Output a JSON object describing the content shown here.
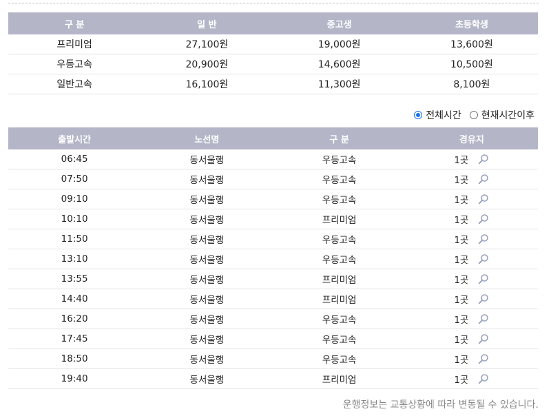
{
  "fare_table": {
    "headers": [
      "구 분",
      "일 반",
      "중고생",
      "초등학생"
    ],
    "rows": [
      [
        "프리미엄",
        "27,100원",
        "19,000원",
        "13,600원"
      ],
      [
        "우등고속",
        "20,900원",
        "14,600원",
        "10,500원"
      ],
      [
        "일반고속",
        "16,100원",
        "11,300원",
        "8,100원"
      ]
    ]
  },
  "filter": {
    "all_label": "전체시간",
    "after_now_label": "현재시간이후",
    "selected": "all"
  },
  "schedule": {
    "headers": [
      "출발시간",
      "노선명",
      "구 분",
      "경유지"
    ],
    "rows": [
      {
        "time": "06:45",
        "route": "동서울행",
        "type": "우등고속",
        "via": "1곳"
      },
      {
        "time": "07:50",
        "route": "동서울행",
        "type": "우등고속",
        "via": "1곳"
      },
      {
        "time": "09:10",
        "route": "동서울행",
        "type": "우등고속",
        "via": "1곳"
      },
      {
        "time": "10:10",
        "route": "동서울행",
        "type": "프리미엄",
        "via": "1곳"
      },
      {
        "time": "11:50",
        "route": "동서울행",
        "type": "우등고속",
        "via": "1곳"
      },
      {
        "time": "13:10",
        "route": "동서울행",
        "type": "우등고속",
        "via": "1곳"
      },
      {
        "time": "13:55",
        "route": "동서울행",
        "type": "프리미엄",
        "via": "1곳"
      },
      {
        "time": "14:40",
        "route": "동서울행",
        "type": "프리미엄",
        "via": "1곳"
      },
      {
        "time": "16:20",
        "route": "동서울행",
        "type": "우등고속",
        "via": "1곳"
      },
      {
        "time": "17:45",
        "route": "동서울행",
        "type": "우등고속",
        "via": "1곳"
      },
      {
        "time": "18:50",
        "route": "동서울행",
        "type": "우등고속",
        "via": "1곳"
      },
      {
        "time": "19:40",
        "route": "동서울행",
        "type": "프리미엄",
        "via": "1곳"
      }
    ],
    "via_icon": "magnifier-icon"
  },
  "notice": "운행정보는 교통상황에 따라 변동될 수 있습니다.",
  "colors": {
    "header_bg": "#b4b6c8",
    "radio_accent": "#1a73e8"
  }
}
